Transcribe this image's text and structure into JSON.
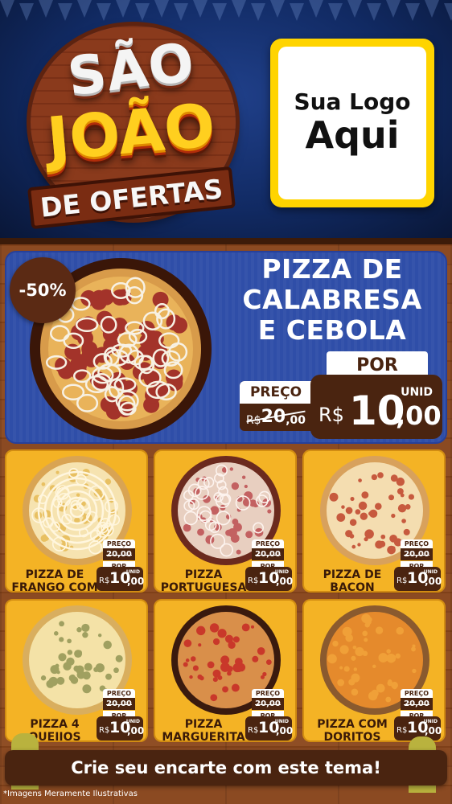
{
  "title": {
    "line1": "SÃO",
    "line2": "JOÃO",
    "line3": "DE OFERTAS"
  },
  "logo": {
    "line1": "Sua Logo",
    "line2": "Aqui"
  },
  "hero": {
    "discount": "-50%",
    "name": "PIZZA DE CALABRESA E CEBOLA",
    "preco_label": "PREÇO",
    "old_currency": "R$",
    "old_int": "20",
    "old_dec": ",00",
    "por_label": "POR",
    "unid_label": "UNID",
    "currency": "R$",
    "price_int": "10",
    "price_dec": ",00"
  },
  "products": [
    {
      "name": "PIZZA DE FRANGO COM CATUPIRY",
      "pizza_icon": "pizza-frango-catupiry-icon",
      "preco_label": "PREÇO",
      "old": "20,00",
      "por_label": "POR",
      "currency": "R$",
      "price_int": "10",
      "price_dec": ",00",
      "unid": "UNID"
    },
    {
      "name": "PIZZA PORTUGUESA",
      "pizza_icon": "pizza-portuguesa-icon",
      "preco_label": "PREÇO",
      "old": "20,00",
      "por_label": "POR",
      "currency": "R$",
      "price_int": "10",
      "price_dec": ",00",
      "unid": "UNID"
    },
    {
      "name": "PIZZA DE BACON",
      "pizza_icon": "pizza-bacon-icon",
      "preco_label": "PREÇO",
      "old": "20,00",
      "por_label": "POR",
      "currency": "R$",
      "price_int": "10",
      "price_dec": ",00",
      "unid": "UNID"
    },
    {
      "name": "PIZZA 4 QUEIJOS",
      "pizza_icon": "pizza-4-queijos-icon",
      "preco_label": "PREÇO",
      "old": "20,00",
      "por_label": "POR",
      "currency": "R$",
      "price_int": "10",
      "price_dec": ",00",
      "unid": "UNID"
    },
    {
      "name": "PIZZA MARGUERITA",
      "pizza_icon": "pizza-marguerita-icon",
      "preco_label": "PREÇO",
      "old": "20,00",
      "por_label": "POR",
      "currency": "R$",
      "price_int": "10",
      "price_dec": ",00",
      "unid": "UNID"
    },
    {
      "name": "PIZZA COM DORITOS",
      "pizza_icon": "pizza-doritos-icon",
      "preco_label": "PREÇO",
      "old": "20,00",
      "por_label": "POR",
      "currency": "R$",
      "price_int": "10",
      "price_dec": ",00",
      "unid": "UNID"
    }
  ],
  "cta": "Crie seu encarte com este tema!",
  "disclaimer": "*Imagens Meramente Ilustrativas",
  "colors": {
    "sky": "#112a63",
    "wood": "#8b4a22",
    "hero_bg": "#2f4ea8",
    "card_bg": "#f4b325",
    "price_bg": "#4a2410",
    "title_yellow": "#ffcf1f",
    "logo_border": "#ffd400"
  }
}
